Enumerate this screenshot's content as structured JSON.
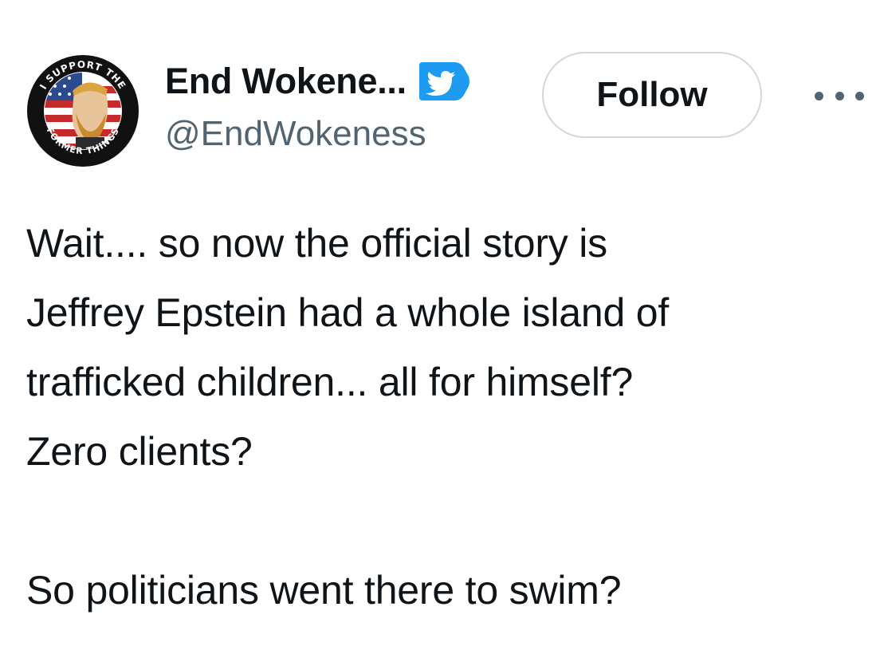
{
  "author": {
    "display_name": "End Wokene...",
    "handle": "@EndWokeness",
    "avatar_text_top": "I SUPPORT THE",
    "avatar_text_bottom": "FORMER THINGS",
    "badge_icon": "verified-bird-badge-icon",
    "badge_color": "#1d9bf0"
  },
  "actions": {
    "follow_label": "Follow",
    "more_icon": "more-options-icon"
  },
  "tweet": {
    "lines": [
      "Wait.... so now the official story is",
      "Jeffrey Epstein had a whole island of",
      "trafficked children... all for himself?",
      "Zero clients?",
      "",
      "So politicians went there to swim?"
    ]
  },
  "colors": {
    "text_primary": "#0f1419",
    "text_secondary": "#536471",
    "button_border": "#cfd9de",
    "accent": "#1d9bf0"
  }
}
